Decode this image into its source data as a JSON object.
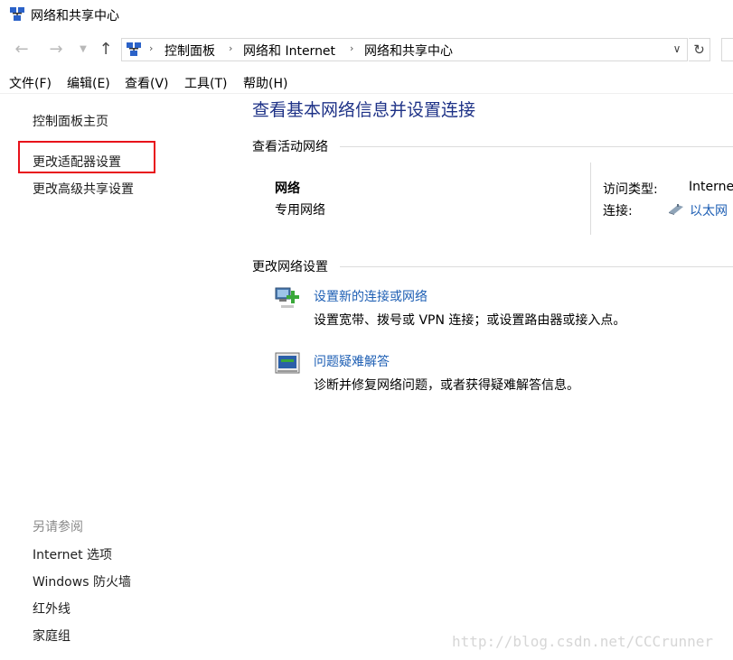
{
  "window": {
    "title": "网络和共享中心"
  },
  "nav": {
    "back_icon": "back-arrow-icon",
    "forward_icon": "forward-arrow-icon",
    "recent_icon": "chevron-down-icon",
    "up_icon": "up-arrow-icon"
  },
  "address": {
    "crumbs": [
      "控制面板",
      "网络和 Internet",
      "网络和共享中心"
    ]
  },
  "menu": [
    "文件(F)",
    "编辑(E)",
    "查看(V)",
    "工具(T)",
    "帮助(H)"
  ],
  "sidebar": {
    "home": "控制面板主页",
    "items": [
      "更改适配器设置",
      "更改高级共享设置"
    ],
    "see_also_title": "另请参阅",
    "see_also": [
      "Internet 选项",
      "Windows 防火墙",
      "红外线",
      "家庭组"
    ]
  },
  "main": {
    "title": "查看基本网络信息并设置连接",
    "active_networks_heading": "查看活动网络",
    "network_name": "网络",
    "network_type": "专用网络",
    "access_type_label": "访问类型:",
    "access_type_value": "Interne",
    "connection_label": "连接:",
    "connection_value": "以太网",
    "change_settings_heading": "更改网络设置",
    "tasks": [
      {
        "link": "设置新的连接或网络",
        "desc": "设置宽带、拨号或 VPN 连接；或设置路由器或接入点。"
      },
      {
        "link": "问题疑难解答",
        "desc": "诊断并修复网络问题，或者获得疑难解答信息。"
      }
    ]
  },
  "watermark": "http://blog.csdn.net/CCCrunner",
  "colors": {
    "link": "#1e5fb4",
    "title": "#1e3287",
    "highlight": "#e8111a"
  }
}
